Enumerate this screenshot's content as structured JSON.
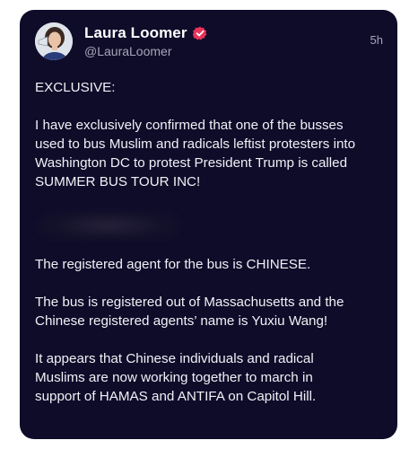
{
  "post": {
    "author": {
      "display_name": "Laura Loomer",
      "handle": "@LauraLoomer",
      "verified_badge_icon": "verified-badge-icon",
      "avatar_icon": "avatar-photo"
    },
    "timestamp": "5h",
    "paragraphs": [
      "EXCLUSIVE:",
      "I have exclusively confirmed that one of the busses\nused to bus Muslim and radicals leftist protesters into\nWashington DC to protest President Trump is called\nSUMMER BUS TOUR INC!"
    ],
    "redacted_block": "",
    "paragraphs_after": [
      "The registered agent for the bus is CHINESE.",
      "The bus is registered out of Massachusetts and the\nChinese registered agents’ name is Yuxiu Wang!",
      "It appears that Chinese individuals and radical\nMuslims are now working together to march in\nsupport of HAMAS and ANTIFA on Capitol Hill."
    ]
  },
  "colors": {
    "card_background": "#0f0c2a",
    "badge": "#e8335a",
    "muted_text": "#a7a5b8"
  }
}
